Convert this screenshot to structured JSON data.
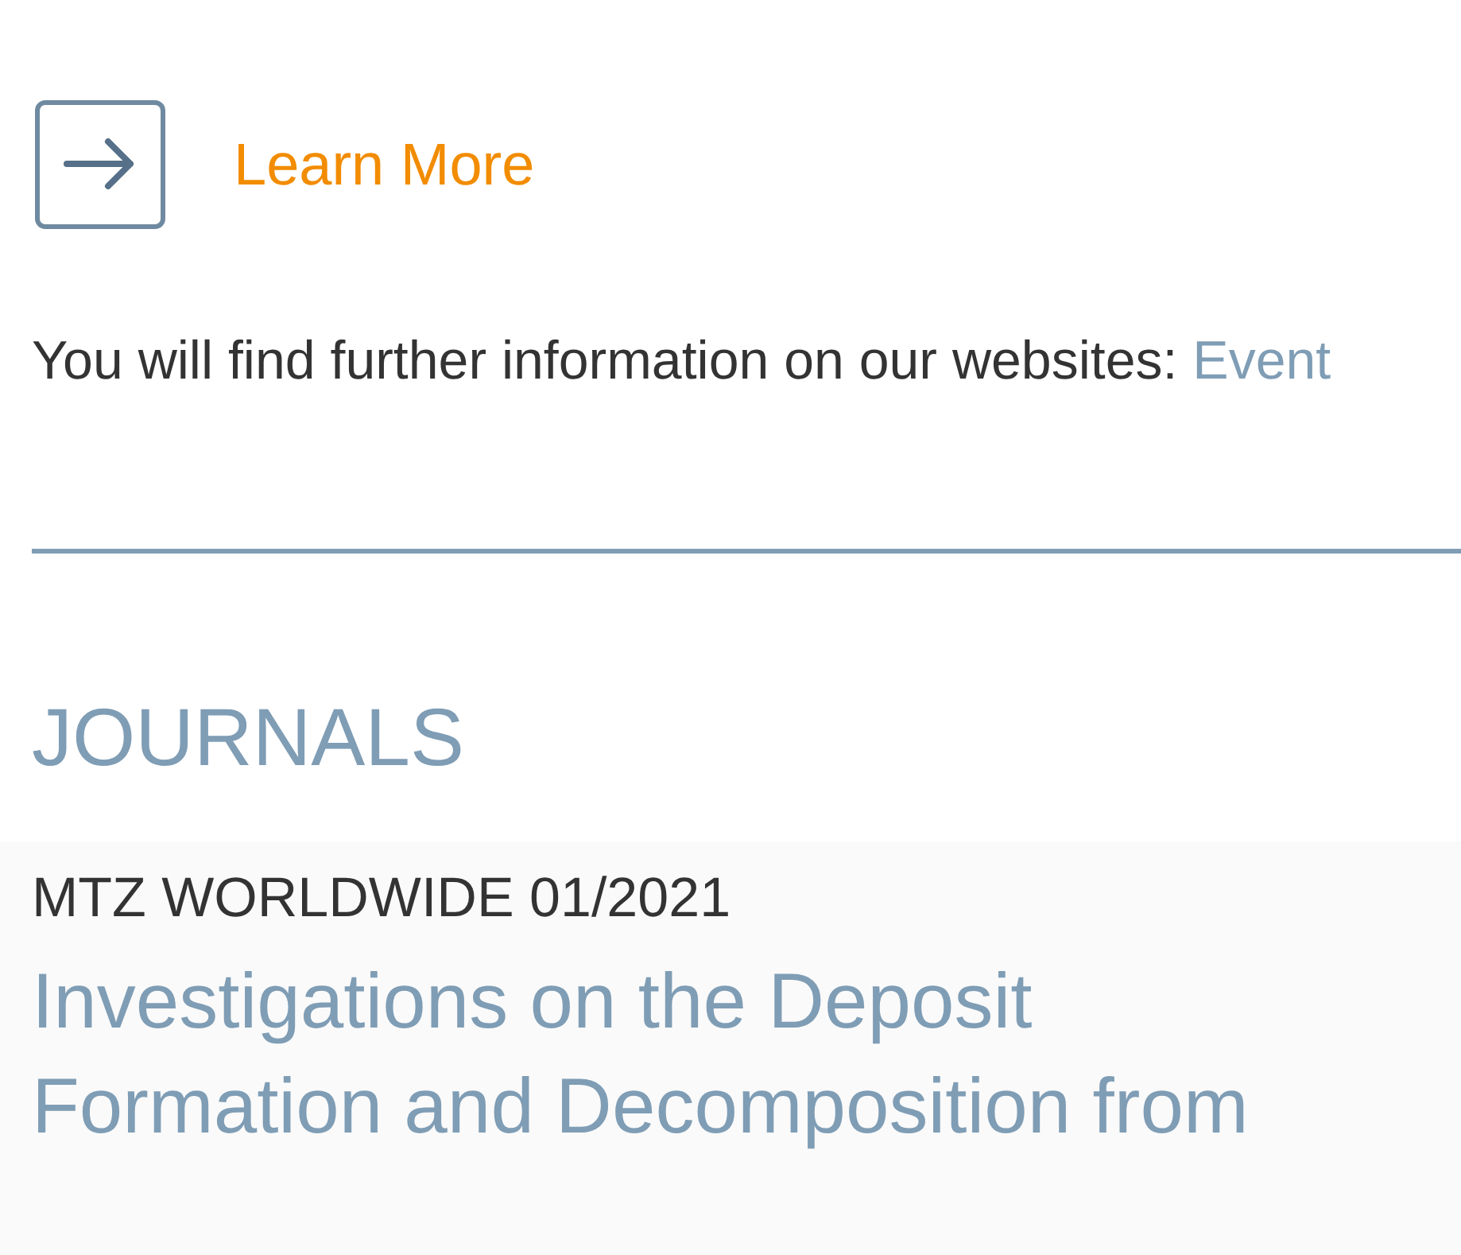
{
  "learn_more": {
    "label": "Learn More"
  },
  "info": {
    "text": "You will find further information on our websites:",
    "link": "Event"
  },
  "journals": {
    "heading": "JOURNALS",
    "items": [
      {
        "source": "MTZ WORLDWIDE 01/2021",
        "title": "Investigations on the Deposit Formation and Decomposition from"
      }
    ]
  }
}
